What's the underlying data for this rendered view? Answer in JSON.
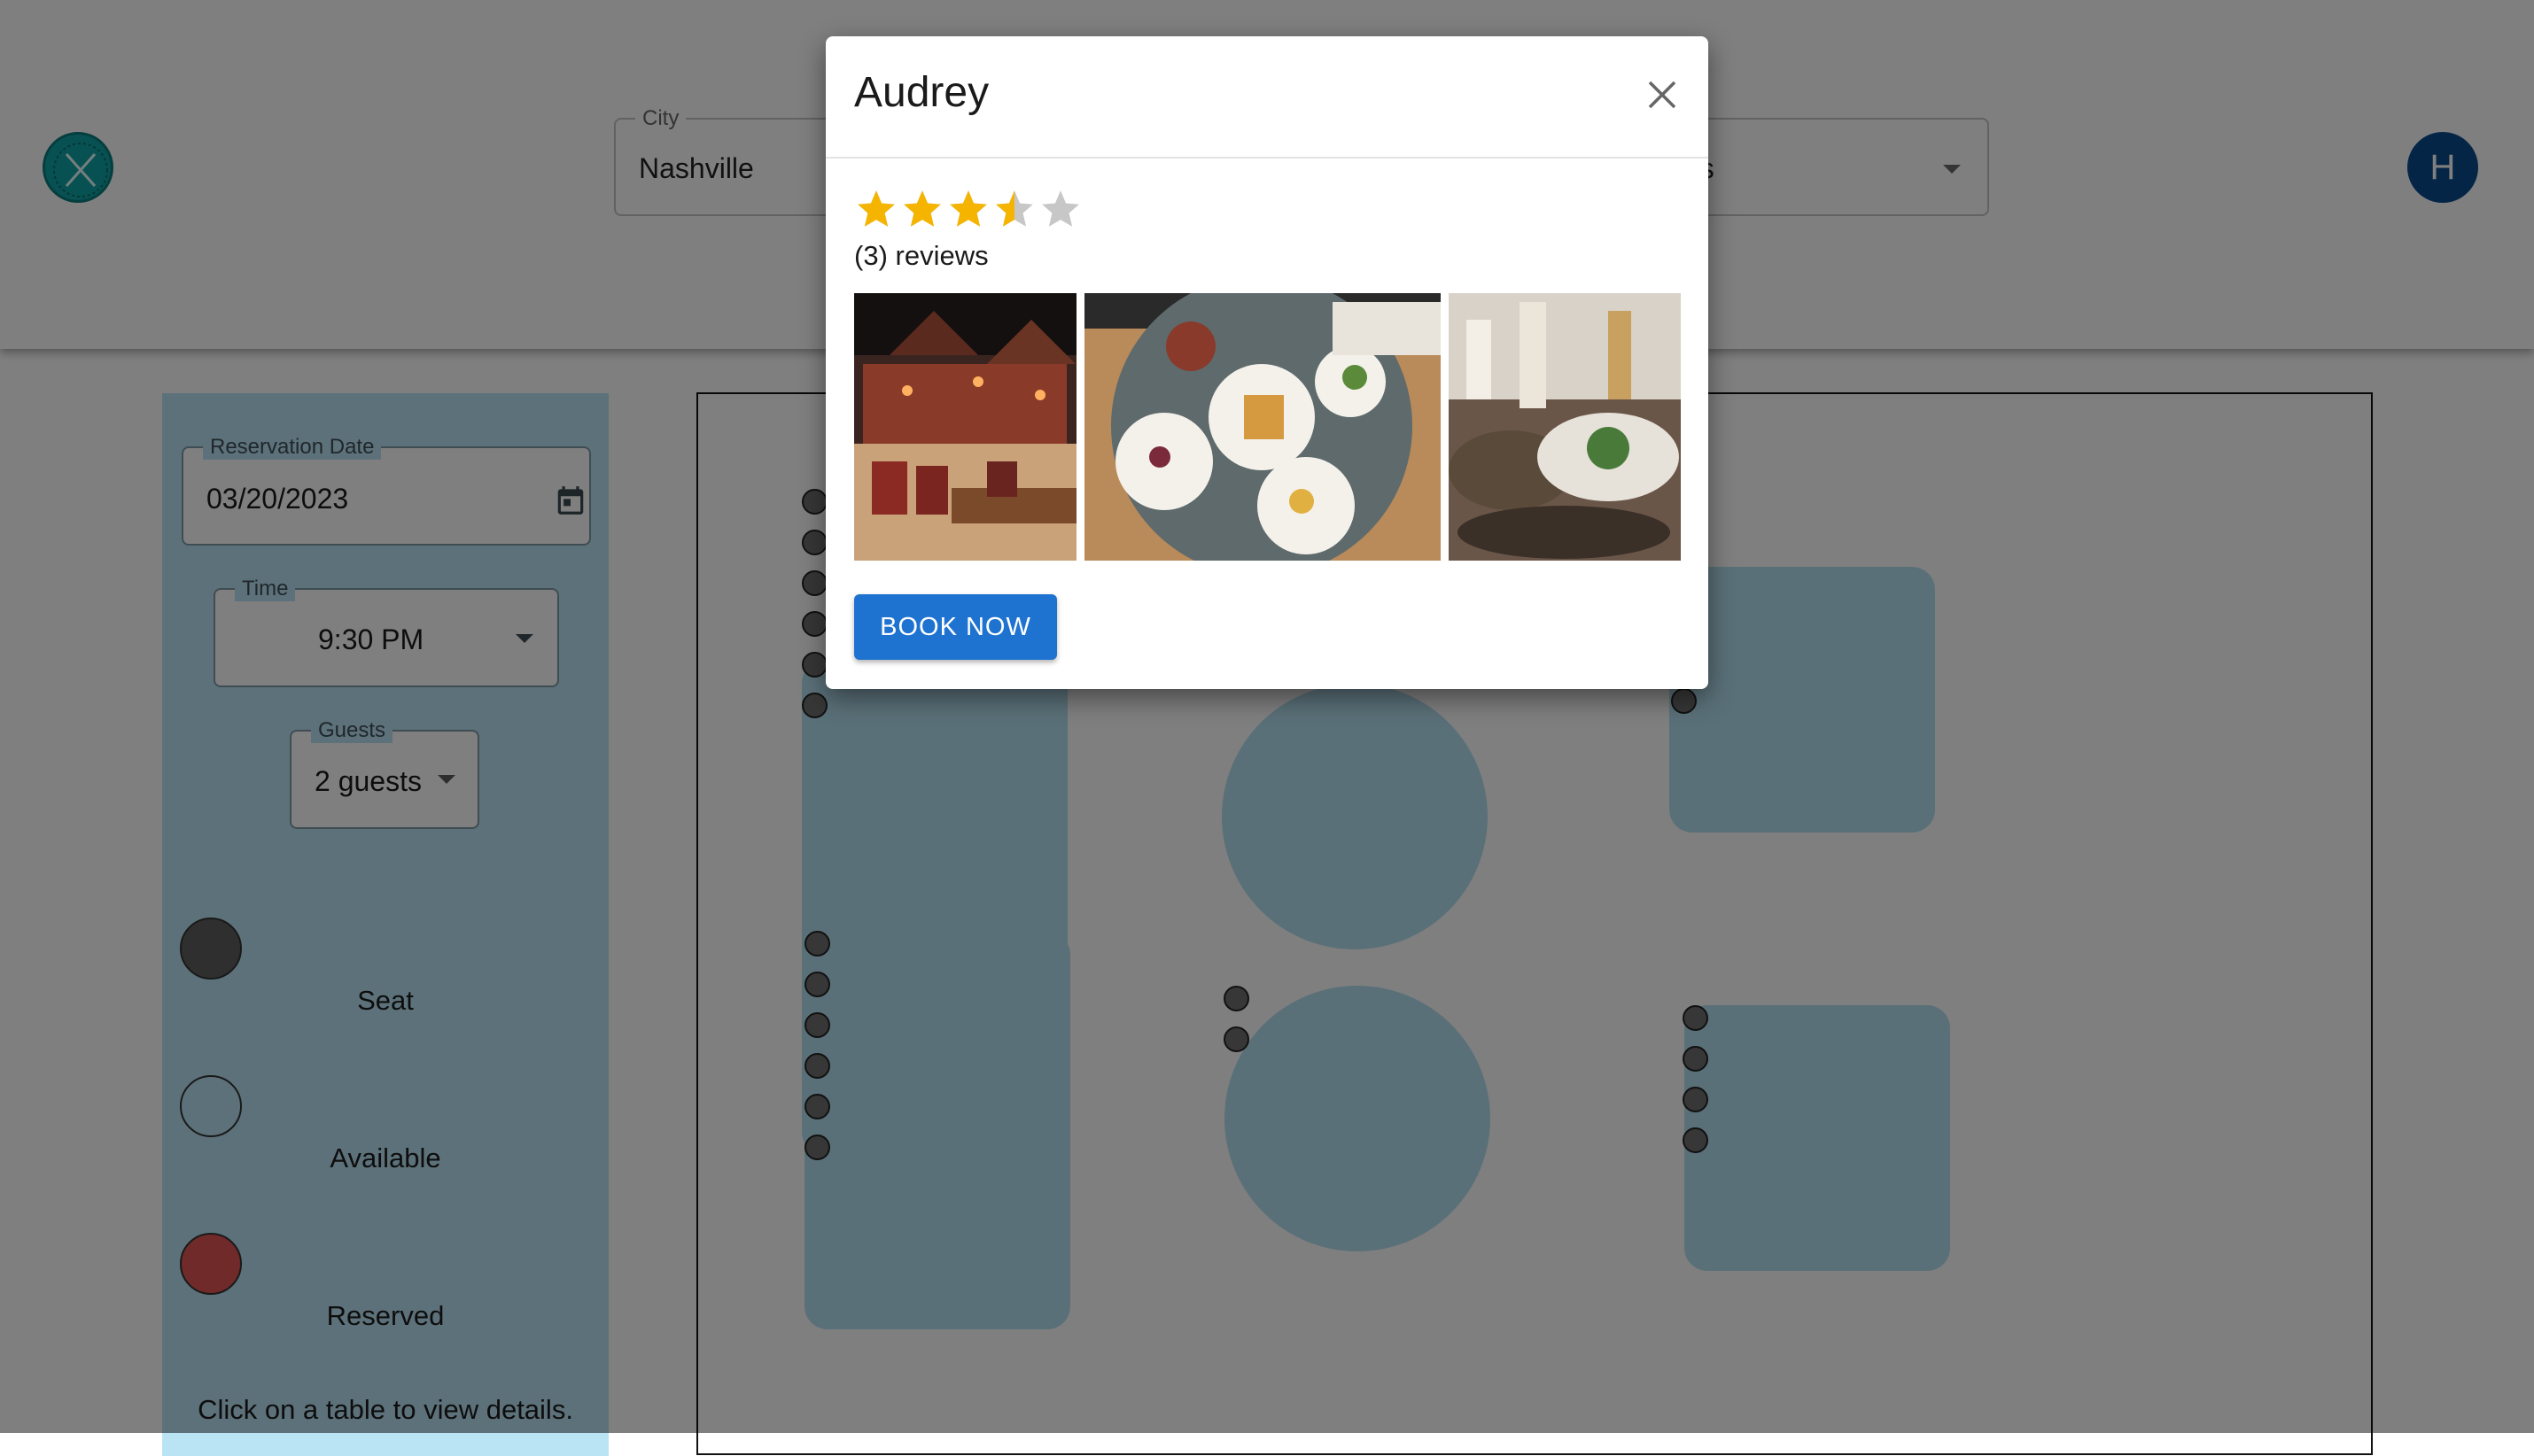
{
  "header": {
    "city": {
      "label": "City",
      "value": "Nashville"
    },
    "search": {
      "value_visible": "nts"
    },
    "user_initial": "H"
  },
  "sidebar": {
    "reservation_date": {
      "label": "Reservation Date",
      "value": "03/20/2023"
    },
    "time": {
      "label": "Time",
      "value": "9:30 PM"
    },
    "guests": {
      "label": "Guests",
      "value": "2 guests"
    },
    "legend": [
      {
        "label": "Seat",
        "color": "#5e5e5e"
      },
      {
        "label": "Available",
        "color": "transparent"
      },
      {
        "label": "Reserved",
        "color": "#e05555"
      }
    ],
    "hint": "Click on a table to view details."
  },
  "modal": {
    "title": "Audrey",
    "rating": 3.5,
    "rating_max": 5,
    "reviews": "(3) reviews",
    "photos": [
      "restaurant-interior-photo",
      "brunch-table-photo",
      "wine-dinner-photo"
    ],
    "book_button": "BOOK NOW"
  },
  "colors": {
    "accent": "#1f73d0",
    "logo": "#11a2a4",
    "avatar": "#0a4a8f",
    "table": "#b4e0f1",
    "sidebar": "#bae3f4",
    "star": "#f5b400"
  }
}
